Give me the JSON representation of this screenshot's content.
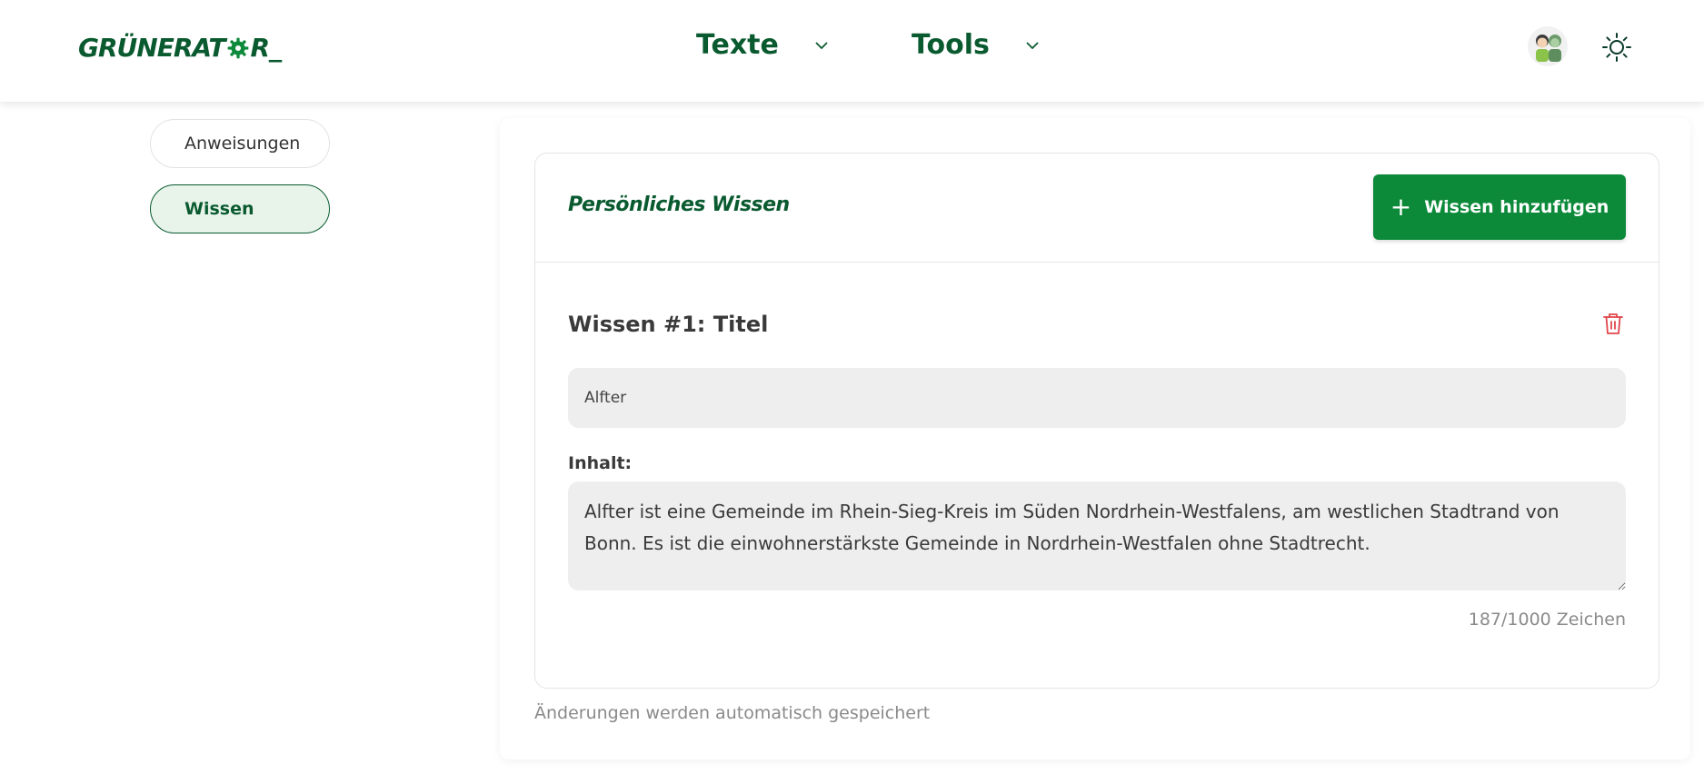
{
  "header": {
    "logo_text_left": "GRÜNERAT",
    "logo_text_right": "R_",
    "nav": [
      {
        "label": "Texte"
      },
      {
        "label": "Tools"
      }
    ]
  },
  "sidebar": {
    "items": [
      {
        "label": "Anweisungen",
        "active": false
      },
      {
        "label": "Wissen",
        "active": true
      }
    ]
  },
  "card": {
    "title": "Persönliches Wissen",
    "add_button_label": "Wissen hinzufügen",
    "entry": {
      "heading": "Wissen #1: Titel",
      "title_value": "Alfter",
      "content_label": "Inhalt:",
      "content_value": "Alfter ist eine Gemeinde im Rhein-Sieg-Kreis im Süden Nordrhein-Westfalens, am westlichen Stadtrand von Bonn. Es ist die einwohnerstärkste Gemeinde in Nordrhein-Westfalen ohne Stadtrecht.",
      "char_count": "187/1000 Zeichen"
    }
  },
  "footer_note": "Änderungen werden automatisch gespeichert",
  "colors": {
    "brand_dark_green": "#0a5a30",
    "button_green": "#0c8a3a",
    "delete_red": "#e0454b",
    "active_bg": "#e8f4ea"
  }
}
